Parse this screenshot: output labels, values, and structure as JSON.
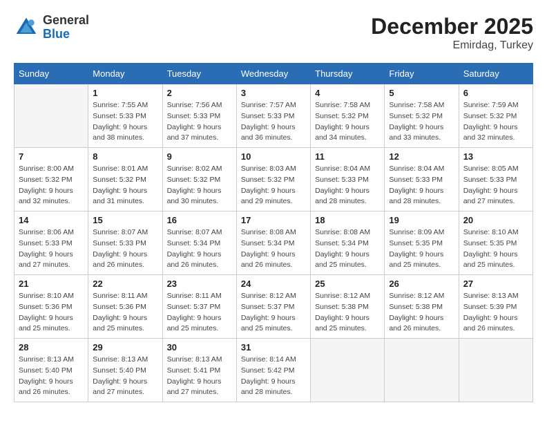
{
  "header": {
    "logo_general": "General",
    "logo_blue": "Blue",
    "month": "December 2025",
    "location": "Emirdag, Turkey"
  },
  "days_of_week": [
    "Sunday",
    "Monday",
    "Tuesday",
    "Wednesday",
    "Thursday",
    "Friday",
    "Saturday"
  ],
  "weeks": [
    [
      {
        "day": "",
        "empty": true
      },
      {
        "day": "1",
        "sunrise": "7:55 AM",
        "sunset": "5:33 PM",
        "daylight": "9 hours and 38 minutes."
      },
      {
        "day": "2",
        "sunrise": "7:56 AM",
        "sunset": "5:33 PM",
        "daylight": "9 hours and 37 minutes."
      },
      {
        "day": "3",
        "sunrise": "7:57 AM",
        "sunset": "5:33 PM",
        "daylight": "9 hours and 36 minutes."
      },
      {
        "day": "4",
        "sunrise": "7:58 AM",
        "sunset": "5:32 PM",
        "daylight": "9 hours and 34 minutes."
      },
      {
        "day": "5",
        "sunrise": "7:58 AM",
        "sunset": "5:32 PM",
        "daylight": "9 hours and 33 minutes."
      },
      {
        "day": "6",
        "sunrise": "7:59 AM",
        "sunset": "5:32 PM",
        "daylight": "9 hours and 32 minutes."
      }
    ],
    [
      {
        "day": "7",
        "sunrise": "8:00 AM",
        "sunset": "5:32 PM",
        "daylight": "9 hours and 32 minutes."
      },
      {
        "day": "8",
        "sunrise": "8:01 AM",
        "sunset": "5:32 PM",
        "daylight": "9 hours and 31 minutes."
      },
      {
        "day": "9",
        "sunrise": "8:02 AM",
        "sunset": "5:32 PM",
        "daylight": "9 hours and 30 minutes."
      },
      {
        "day": "10",
        "sunrise": "8:03 AM",
        "sunset": "5:32 PM",
        "daylight": "9 hours and 29 minutes."
      },
      {
        "day": "11",
        "sunrise": "8:04 AM",
        "sunset": "5:33 PM",
        "daylight": "9 hours and 28 minutes."
      },
      {
        "day": "12",
        "sunrise": "8:04 AM",
        "sunset": "5:33 PM",
        "daylight": "9 hours and 28 minutes."
      },
      {
        "day": "13",
        "sunrise": "8:05 AM",
        "sunset": "5:33 PM",
        "daylight": "9 hours and 27 minutes."
      }
    ],
    [
      {
        "day": "14",
        "sunrise": "8:06 AM",
        "sunset": "5:33 PM",
        "daylight": "9 hours and 27 minutes."
      },
      {
        "day": "15",
        "sunrise": "8:07 AM",
        "sunset": "5:33 PM",
        "daylight": "9 hours and 26 minutes."
      },
      {
        "day": "16",
        "sunrise": "8:07 AM",
        "sunset": "5:34 PM",
        "daylight": "9 hours and 26 minutes."
      },
      {
        "day": "17",
        "sunrise": "8:08 AM",
        "sunset": "5:34 PM",
        "daylight": "9 hours and 26 minutes."
      },
      {
        "day": "18",
        "sunrise": "8:08 AM",
        "sunset": "5:34 PM",
        "daylight": "9 hours and 25 minutes."
      },
      {
        "day": "19",
        "sunrise": "8:09 AM",
        "sunset": "5:35 PM",
        "daylight": "9 hours and 25 minutes."
      },
      {
        "day": "20",
        "sunrise": "8:10 AM",
        "sunset": "5:35 PM",
        "daylight": "9 hours and 25 minutes."
      }
    ],
    [
      {
        "day": "21",
        "sunrise": "8:10 AM",
        "sunset": "5:36 PM",
        "daylight": "9 hours and 25 minutes."
      },
      {
        "day": "22",
        "sunrise": "8:11 AM",
        "sunset": "5:36 PM",
        "daylight": "9 hours and 25 minutes."
      },
      {
        "day": "23",
        "sunrise": "8:11 AM",
        "sunset": "5:37 PM",
        "daylight": "9 hours and 25 minutes."
      },
      {
        "day": "24",
        "sunrise": "8:12 AM",
        "sunset": "5:37 PM",
        "daylight": "9 hours and 25 minutes."
      },
      {
        "day": "25",
        "sunrise": "8:12 AM",
        "sunset": "5:38 PM",
        "daylight": "9 hours and 25 minutes."
      },
      {
        "day": "26",
        "sunrise": "8:12 AM",
        "sunset": "5:38 PM",
        "daylight": "9 hours and 26 minutes."
      },
      {
        "day": "27",
        "sunrise": "8:13 AM",
        "sunset": "5:39 PM",
        "daylight": "9 hours and 26 minutes."
      }
    ],
    [
      {
        "day": "28",
        "sunrise": "8:13 AM",
        "sunset": "5:40 PM",
        "daylight": "9 hours and 26 minutes."
      },
      {
        "day": "29",
        "sunrise": "8:13 AM",
        "sunset": "5:40 PM",
        "daylight": "9 hours and 27 minutes."
      },
      {
        "day": "30",
        "sunrise": "8:13 AM",
        "sunset": "5:41 PM",
        "daylight": "9 hours and 27 minutes."
      },
      {
        "day": "31",
        "sunrise": "8:14 AM",
        "sunset": "5:42 PM",
        "daylight": "9 hours and 28 minutes."
      },
      {
        "day": "",
        "empty": true
      },
      {
        "day": "",
        "empty": true
      },
      {
        "day": "",
        "empty": true
      }
    ]
  ]
}
